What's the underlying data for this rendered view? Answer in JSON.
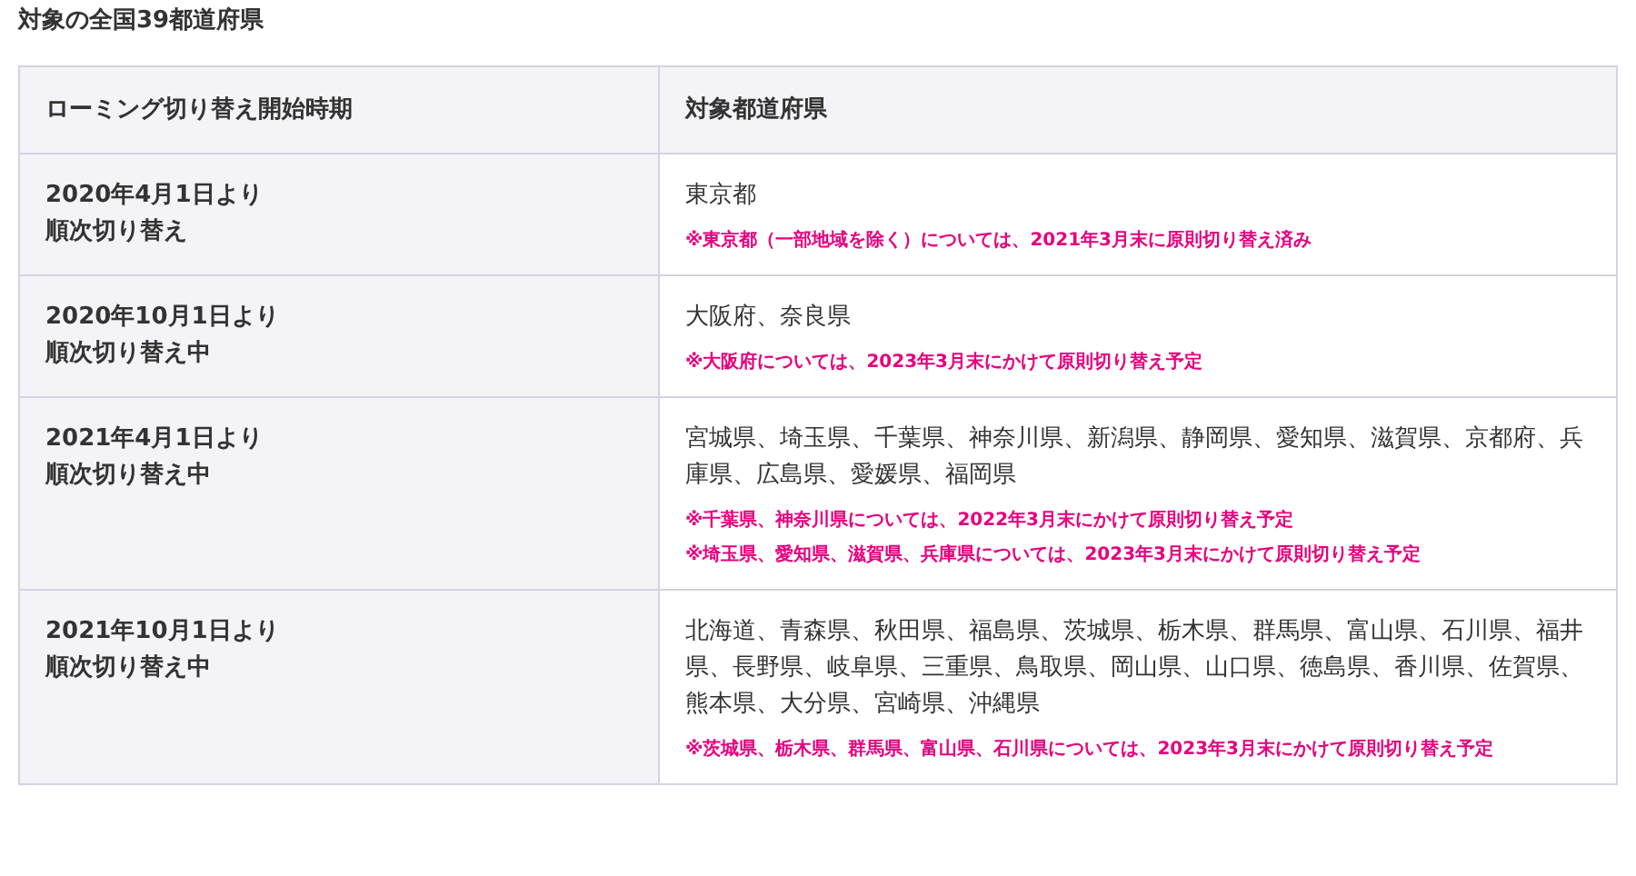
{
  "title": "対象の全国39都道府県",
  "table": {
    "columns": [
      "ローミング切り替え開始時期",
      "対象都道府県"
    ],
    "rows": [
      {
        "period": [
          "2020年4月1日より",
          "順次切り替え"
        ],
        "prefectures": "東京都",
        "notes": [
          "※東京都（一部地域を除く）については、2021年3月末に原則切り替え済み"
        ]
      },
      {
        "period": [
          "2020年10月1日より",
          "順次切り替え中"
        ],
        "prefectures": "大阪府、奈良県",
        "notes": [
          "※大阪府については、2023年3月末にかけて原則切り替え予定"
        ]
      },
      {
        "period": [
          "2021年4月1日より",
          "順次切り替え中"
        ],
        "prefectures": "宮城県、埼玉県、千葉県、神奈川県、新潟県、静岡県、愛知県、滋賀県、京都府、兵庫県、広島県、愛媛県、福岡県",
        "notes": [
          "※千葉県、神奈川県については、2022年3月末にかけて原則切り替え予定",
          "※埼玉県、愛知県、滋賀県、兵庫県については、2023年3月末にかけて原則切り替え予定"
        ]
      },
      {
        "period": [
          "2021年10月1日より",
          "順次切り替え中"
        ],
        "prefectures": "北海道、青森県、秋田県、福島県、茨城県、栃木県、群馬県、富山県、石川県、福井県、長野県、岐阜県、三重県、鳥取県、岡山県、山口県、徳島県、香川県、佐賀県、熊本県、大分県、宮崎県、沖縄県",
        "notes": [
          "※茨城県、栃木県、群馬県、富山県、石川県については、2023年3月末にかけて原則切り替え予定"
        ]
      }
    ]
  }
}
